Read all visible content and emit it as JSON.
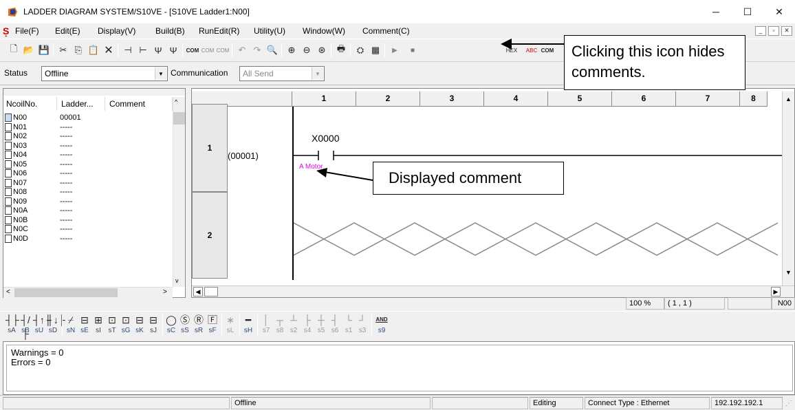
{
  "window": {
    "title": "LADDER DIAGRAM SYSTEM/S10VE - [S10VE Ladder1:N00]",
    "minimize": "─",
    "maximize": "☐",
    "close": "✕"
  },
  "menu": [
    {
      "label": "File(F)"
    },
    {
      "label": "Edit(E)"
    },
    {
      "label": "Display(V)"
    },
    {
      "label": "Build(B)"
    },
    {
      "label": "RunEdit(R)"
    },
    {
      "label": "Utility(U)"
    },
    {
      "label": "Window(W)"
    },
    {
      "label": "Comment(C)"
    }
  ],
  "toolbar": {
    "icons": [
      "new-icon",
      "open-icon",
      "save-icon",
      "cut-icon",
      "copy-icon",
      "paste-icon",
      "delete-icon",
      "insert-row-icon",
      "insert-col-icon",
      "branch-icon",
      "branch2-icon",
      "comment-show-icon",
      "comment-edit-icon",
      "comment-list-icon",
      "undo-icon",
      "redo-icon",
      "find-icon",
      "zoom-in-icon",
      "zoom-out-icon",
      "zoom-fit-icon",
      "print-icon",
      "build-icon",
      "monitor-icon",
      "play-icon",
      "hex-icon",
      "abc-icon",
      "comment-hide-icon"
    ],
    "hex_label": "HEX",
    "abc_label": "ABC"
  },
  "toolbar2": {
    "status_label": "Status",
    "status_value": "Offline",
    "communication_label": "Communication",
    "communication_value": "All Send"
  },
  "coil_list": {
    "headers": [
      "NcoilNo.",
      "Ladder...",
      "Comment"
    ],
    "rows": [
      {
        "no": "N00",
        "ladder": "00001"
      },
      {
        "no": "N01",
        "ladder": "-----"
      },
      {
        "no": "N02",
        "ladder": "-----"
      },
      {
        "no": "N03",
        "ladder": "-----"
      },
      {
        "no": "N04",
        "ladder": "-----"
      },
      {
        "no": "N05",
        "ladder": "-----"
      },
      {
        "no": "N06",
        "ladder": "-----"
      },
      {
        "no": "N07",
        "ladder": "-----"
      },
      {
        "no": "N08",
        "ladder": "-----"
      },
      {
        "no": "N09",
        "ladder": "-----"
      },
      {
        "no": "N0A",
        "ladder": "-----"
      },
      {
        "no": "N0B",
        "ladder": "-----"
      },
      {
        "no": "N0C",
        "ladder": "-----"
      },
      {
        "no": "N0D",
        "ladder": "-----"
      }
    ]
  },
  "ladder": {
    "columns": [
      "1",
      "2",
      "3",
      "4",
      "5",
      "6",
      "7",
      "8"
    ],
    "rows": [
      {
        "num": "1",
        "ref": "(00001)",
        "contact": "X0000",
        "comment": "A Motor"
      },
      {
        "num": "2"
      }
    ]
  },
  "callouts": {
    "hide_comments": "Clicking this icon hides comments.",
    "displayed_comment": "Displayed comment"
  },
  "ladder_status": {
    "zoom": "100 %",
    "cursor": "( 1 , 1 )",
    "coil": "N00"
  },
  "instructions": [
    {
      "sym": "┤├",
      "lbl": "sA"
    },
    {
      "sym": "┤/├",
      "lbl": "sB"
    },
    {
      "sym": "┤↑├",
      "lbl": "sU"
    },
    {
      "sym": "┤↓├",
      "lbl": "sD"
    },
    {
      "sym": "⌿",
      "lbl": "sN"
    },
    {
      "sym": "⊟",
      "lbl": "sE"
    },
    {
      "sym": "⊞",
      "lbl": "sI"
    },
    {
      "sym": "⊡",
      "lbl": "sT"
    },
    {
      "sym": "⊡",
      "lbl": "sG"
    },
    {
      "sym": "⊟",
      "lbl": "sK"
    },
    {
      "sym": "⊟",
      "lbl": "sJ"
    },
    {
      "sym": "◯",
      "lbl": "sC"
    },
    {
      "sym": "Ⓢ",
      "lbl": "sS"
    },
    {
      "sym": "Ⓡ",
      "lbl": "sR"
    },
    {
      "sym": "🄵",
      "lbl": "sF"
    },
    {
      "sym": "∗",
      "lbl": "sL",
      "dis": true
    },
    {
      "sym": "━",
      "lbl": "sH"
    },
    {
      "sym": "│",
      "lbl": "s7",
      "dis": true
    },
    {
      "sym": "┬",
      "lbl": "s8",
      "dis": true
    },
    {
      "sym": "┴",
      "lbl": "s2",
      "dis": true
    },
    {
      "sym": "├",
      "lbl": "s4",
      "dis": true
    },
    {
      "sym": "┼",
      "lbl": "s5",
      "dis": true
    },
    {
      "sym": "┤",
      "lbl": "s6",
      "dis": true
    },
    {
      "sym": "└",
      "lbl": "s1",
      "dis": true
    },
    {
      "sym": "┘",
      "lbl": "s3",
      "dis": true
    },
    {
      "sym": "AND",
      "lbl": "s9"
    }
  ],
  "output": {
    "warnings": "Warnings = 0",
    "errors": "Errors = 0"
  },
  "statusbar": {
    "mode": "Offline",
    "edit": "Editing",
    "connect": "Connect Type : Ethernet",
    "ip": "192.192.192.1"
  }
}
